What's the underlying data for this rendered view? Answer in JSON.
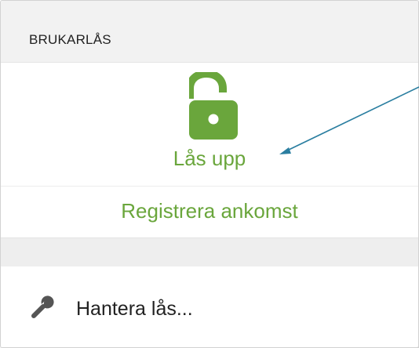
{
  "header": {
    "title": "BRUKARLÅS"
  },
  "actions": {
    "unlock": {
      "label": "Lås upp",
      "icon": "unlock-icon"
    },
    "register": {
      "label": "Registrera ankomst"
    },
    "manage": {
      "label": "Hantera lås...",
      "icon": "wrench-icon"
    }
  },
  "colors": {
    "accent": "#6aa63c",
    "arrow": "#2a7ea0"
  }
}
